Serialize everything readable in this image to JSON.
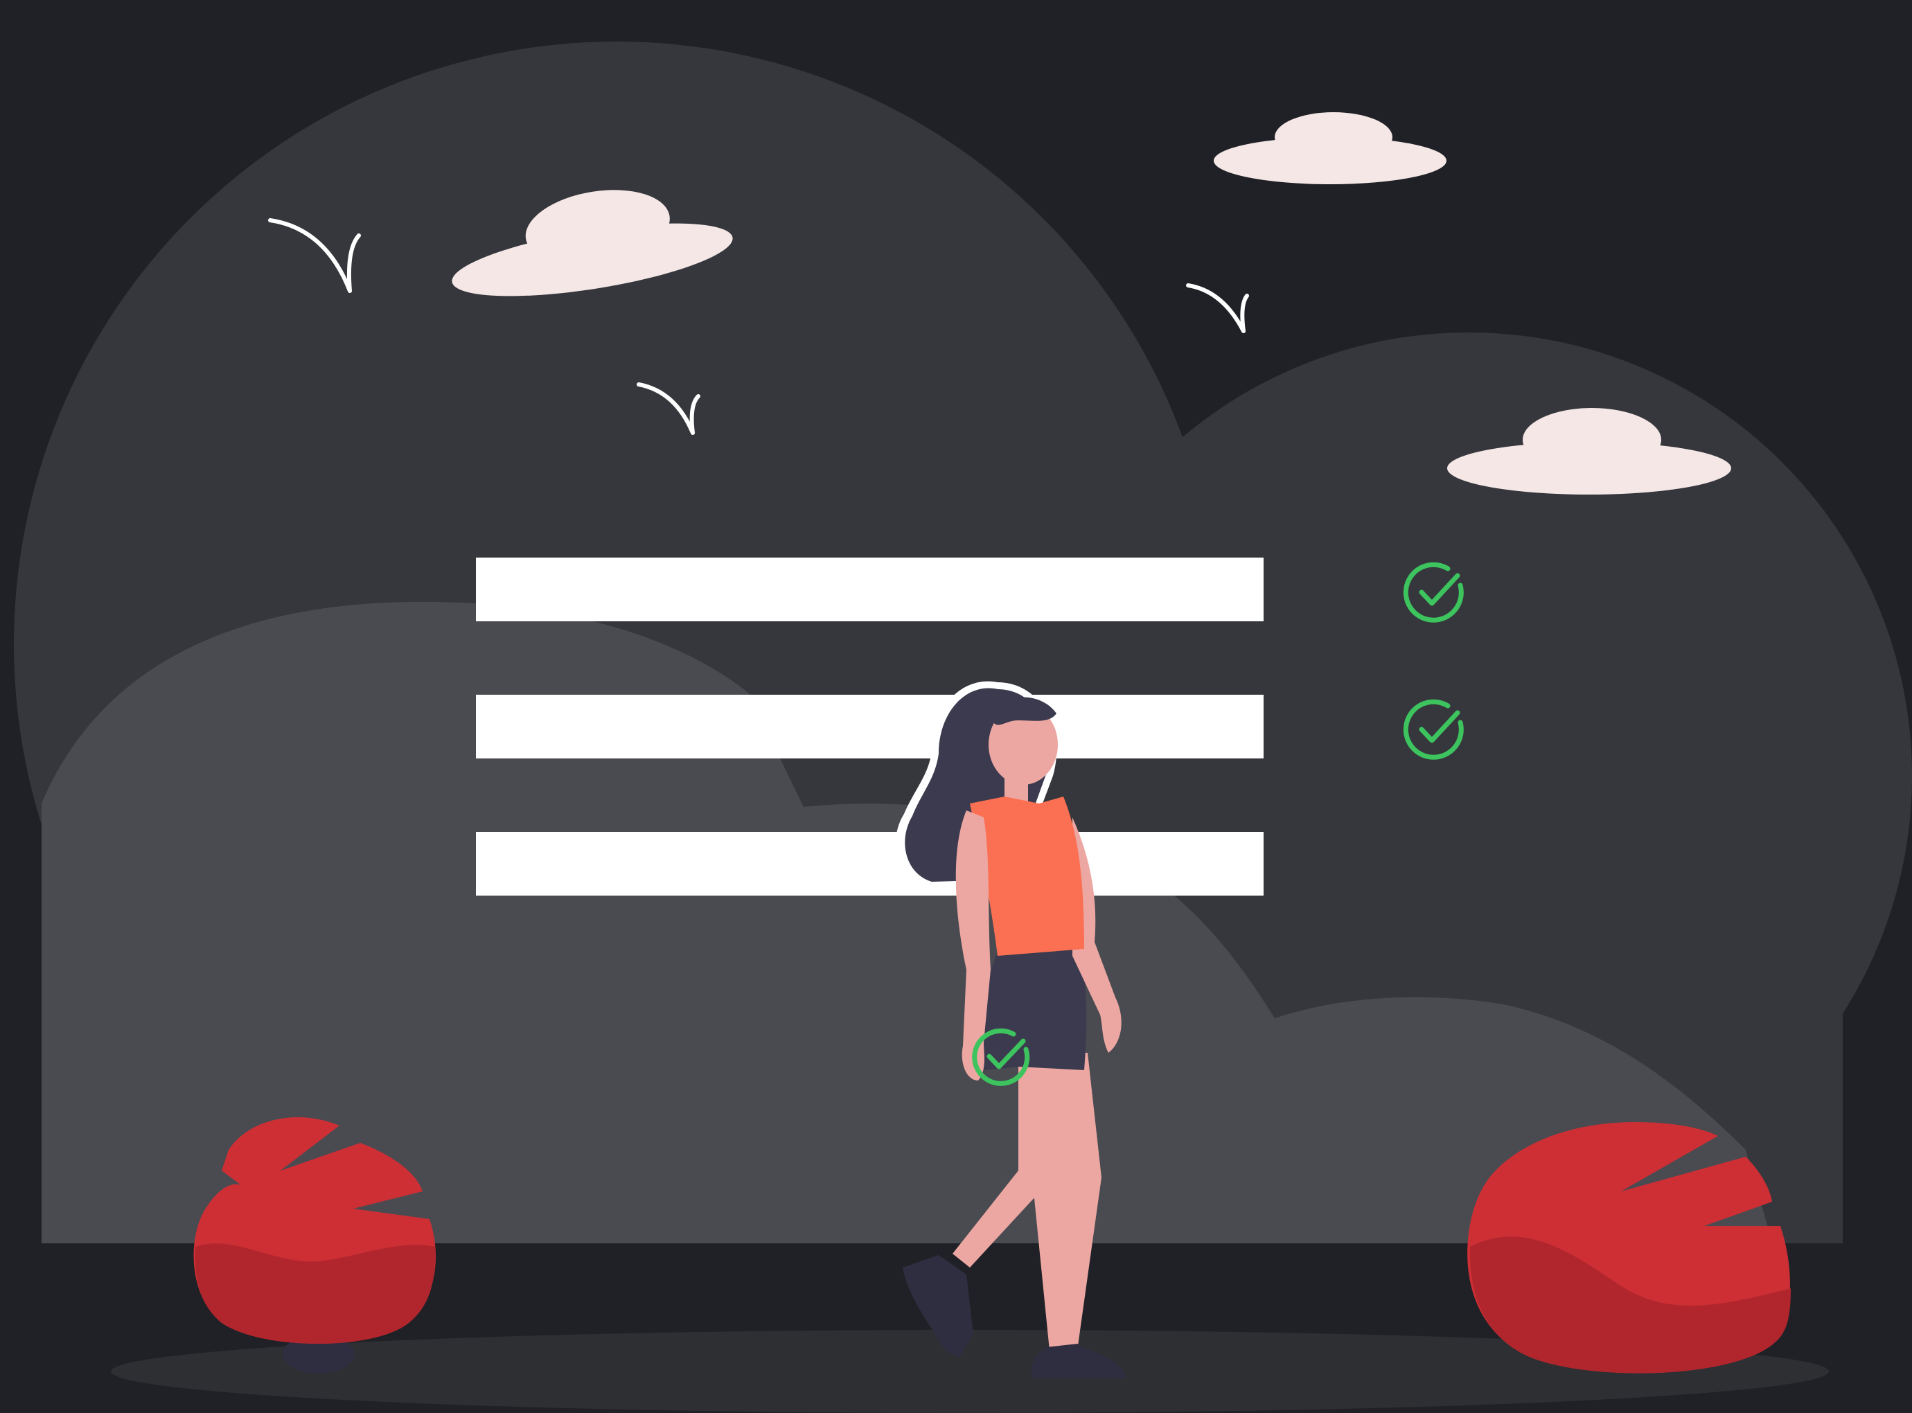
{
  "scene": {
    "kind": "flat vector illustration",
    "colors": {
      "background": "#1f2126",
      "big_hill": "#35373c",
      "front_hill": "#494b51",
      "ground_shadow": "#2d2f33",
      "form_bar": "#ffffff",
      "check": "#3dc45e",
      "cloud": "#f5e7e6",
      "bird": "#ffffff",
      "bush_light": "#cd2f35",
      "bush_dark": "#b1262d",
      "hair": "#3b3a4e",
      "skin": "#eda7a2",
      "top": "#fb6f52",
      "shorts": "#3b3a4e",
      "shoes": "#2f2e41"
    },
    "elements": {
      "form_fields": 3,
      "check_icons": 3,
      "clouds": 3,
      "birds": 3,
      "bushes": 2,
      "person": 1
    }
  }
}
